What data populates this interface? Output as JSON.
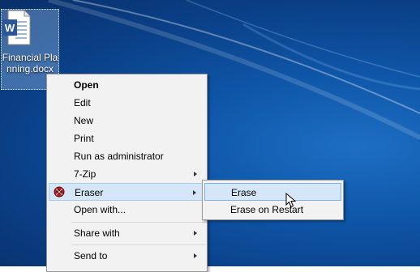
{
  "desktop": {
    "icon_label": "Financial Planning.docx",
    "icon_name": "word-document-icon"
  },
  "context_menu": {
    "items": [
      {
        "label": "Open"
      },
      {
        "label": "Edit"
      },
      {
        "label": "New"
      },
      {
        "label": "Print"
      },
      {
        "label": "Run as administrator"
      },
      {
        "label": "7-Zip"
      },
      {
        "label": "Eraser"
      },
      {
        "label": "Open with..."
      },
      {
        "label": "Share with"
      },
      {
        "label": "Send to"
      }
    ]
  },
  "submenu": {
    "items": [
      {
        "label": "Erase"
      },
      {
        "label": "Erase on Restart"
      }
    ]
  },
  "colors": {
    "desktop_bg": "#0f56a8",
    "menu_bg": "#f2f2f2",
    "highlight": "#d5e6f8",
    "word_blue": "#2b579a"
  }
}
